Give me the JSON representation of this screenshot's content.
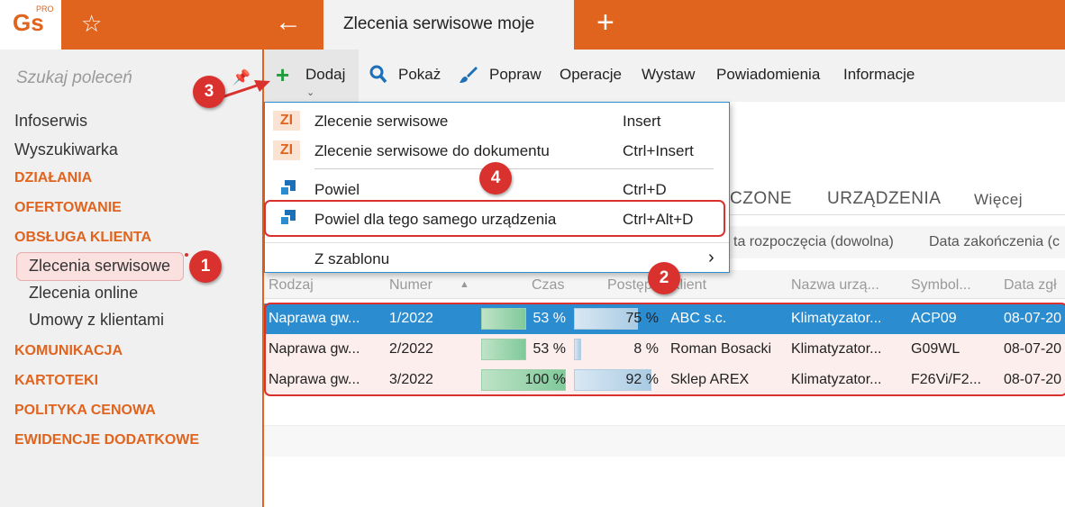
{
  "app": {
    "logo": "Gs",
    "logo_sup": "PRO",
    "window_title": "Zlecenia serwisowe moje"
  },
  "sidebar": {
    "search_placeholder": "Szukaj poleceń",
    "items": [
      "Infoserwis",
      "Wyszukiwarka"
    ],
    "categories_top": [
      "DZIAŁANIA",
      "OFERTOWANIE",
      "OBSŁUGA KLIENTA"
    ],
    "sub_items": [
      "Zlecenia serwisowe",
      "Zlecenia online",
      "Umowy z klientami"
    ],
    "categories_bottom": [
      "KOMUNIKACJA",
      "KARTOTEKI",
      "POLITYKA CENOWA",
      "EWIDENCJE DODATKOWE"
    ]
  },
  "toolbar": {
    "dodaj": "Dodaj",
    "pokaz": "Pokaż",
    "popraw": "Popraw",
    "operacje": "Operacje",
    "wystaw": "Wystaw",
    "powiadomienia": "Powiadomienia",
    "informacje": "Informacje"
  },
  "tabs": {
    "zakonczone": "CZONE",
    "urzadzenia": "URZĄDZENIA",
    "wiecej": "Więcej"
  },
  "filters": {
    "date_start": "ta rozpoczęcia (dowolna)",
    "date_end": "Data zakończenia (c"
  },
  "table": {
    "headers": [
      "Rodzaj",
      "Numer",
      "Czas",
      "Postęp",
      "Klient",
      "Nazwa urzą...",
      "Symbol...",
      "Data zgł"
    ],
    "rows": [
      {
        "rodzaj": "Naprawa gw...",
        "numer": "1/2022",
        "czas": "53 %",
        "postep": "75 %",
        "klient": "ABC s.c.",
        "nazwa": "Klimatyzator...",
        "symbol": "ACP09",
        "data": "08-07-20",
        "czas_value": 53,
        "postep_value": 75
      },
      {
        "rodzaj": "Naprawa gw...",
        "numer": "2/2022",
        "czas": "53 %",
        "postep": "8 %",
        "klient": "Roman Bosacki",
        "nazwa": "Klimatyzator...",
        "symbol": "G09WL",
        "data": "08-07-20",
        "czas_value": 53,
        "postep_value": 8
      },
      {
        "rodzaj": "Naprawa gw...",
        "numer": "3/2022",
        "czas": "100 %",
        "postep": "92 %",
        "klient": "Sklep AREX",
        "nazwa": "Klimatyzator...",
        "symbol": "F26Vi/F2...",
        "data": "08-07-20",
        "czas_value": 100,
        "postep_value": 92
      }
    ]
  },
  "menu": {
    "items": [
      {
        "badge": "ZI",
        "label": "Zlecenie serwisowe",
        "shortcut": "Insert"
      },
      {
        "badge": "ZI",
        "label": "Zlecenie serwisowe do dokumentu",
        "shortcut": "Ctrl+Insert"
      },
      {
        "label": "Powiel",
        "shortcut": "Ctrl+D"
      },
      {
        "label": "Powiel dla tego samego urządzenia",
        "shortcut": "Ctrl+Alt+D"
      },
      {
        "label": "Z szablonu",
        "shortcut": "›"
      }
    ]
  },
  "annotations": [
    "1",
    "2",
    "3",
    "4"
  ],
  "colors": {
    "accent": "#e0641e",
    "selection": "#2b8cd0",
    "annotation": "#d9312e"
  }
}
